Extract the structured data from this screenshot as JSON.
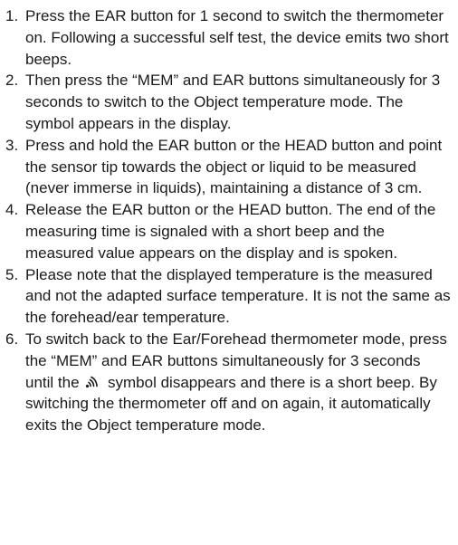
{
  "steps": [
    {
      "number": "1.",
      "text": "Press the EAR button for 1 second to switch the thermometer on. Following a successful self test, the device emits two short beeps."
    },
    {
      "number": "2.",
      "text": "Then press the “MEM” and EAR buttons simultaneously for 3 seconds to switch to the Object temperature mode. The symbol appears in the display."
    },
    {
      "number": "3.",
      "text": "Press and hold the EAR button or the HEAD button and point the sensor tip towards the object or liquid to be measured (never immerse in liquids), maintaining a distance of 3 cm."
    },
    {
      "number": "4.",
      "text": "Release the EAR button or the HEAD button. The end of the measuring time is signaled with a short beep and the measured value appears on the display and is spoken."
    },
    {
      "number": "5.",
      "text": "Please note that the displayed temperature is the measured and not the adapted surface temperature. It is not the same as the forehead/ear temperature."
    },
    {
      "number": "6.",
      "text_before_icon": "To switch back to the Ear/Forehead thermometer mode, press the “MEM” and EAR buttons simultaneously for 3 seconds until the",
      "icon": "object-mode-symbol-icon",
      "text_after_icon": "symbol disappears and there is a short beep. By switching the thermometer off and on again, it automatically exits the Object temperature mode."
    }
  ]
}
